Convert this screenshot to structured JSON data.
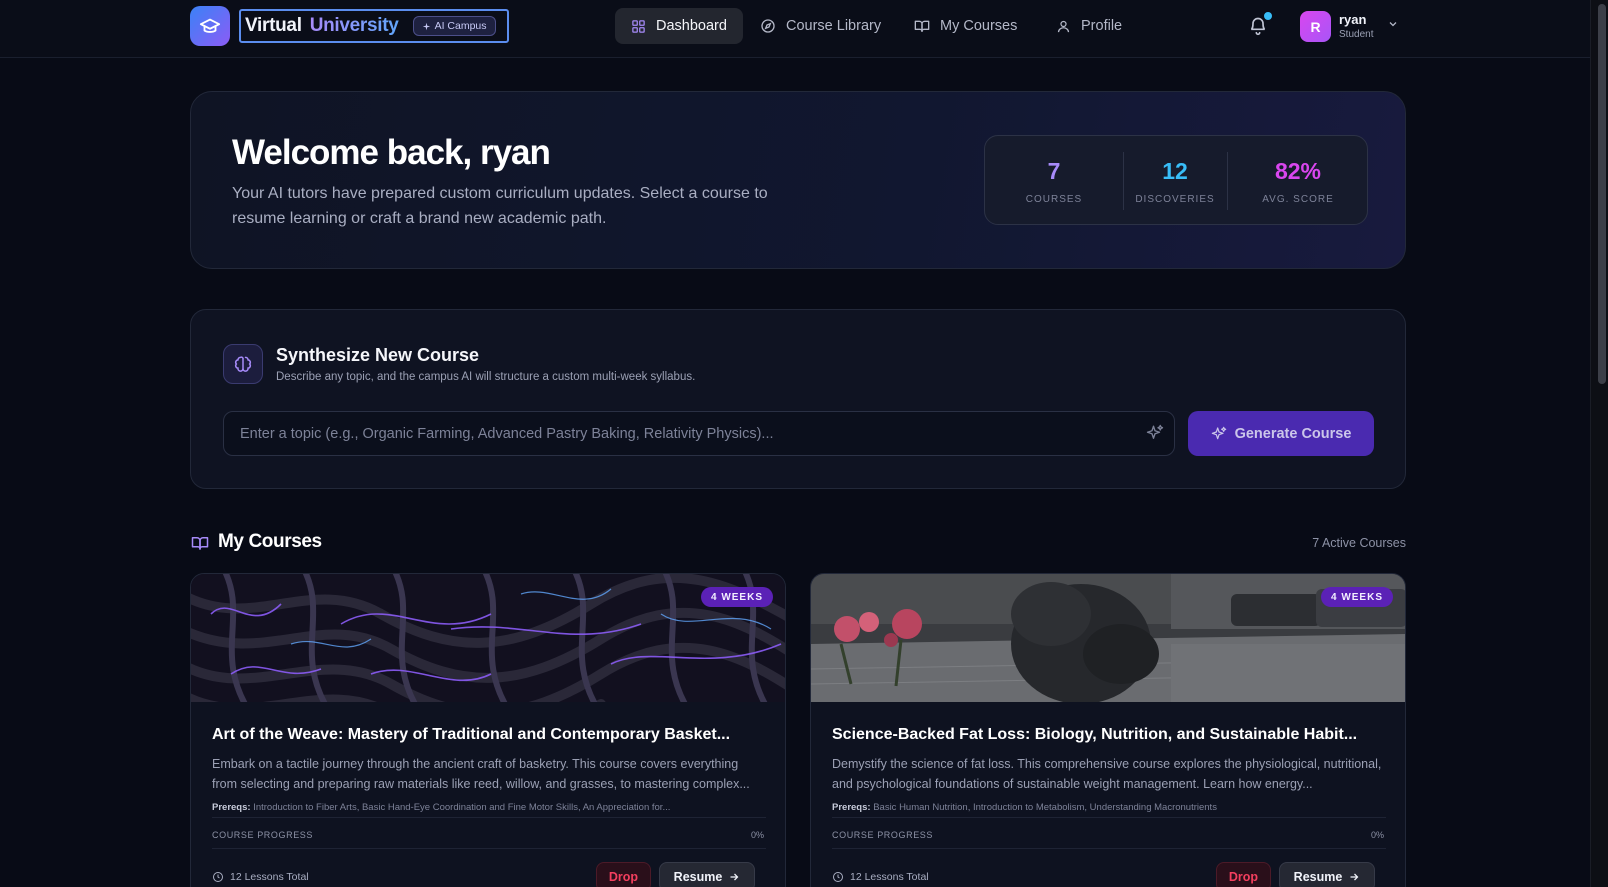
{
  "brand": {
    "name_part1": "Virtual",
    "name_part2": "University",
    "badge": "AI Campus"
  },
  "nav": {
    "items": [
      {
        "label": "Dashboard",
        "icon": "grid-icon",
        "active": true
      },
      {
        "label": "Course Library",
        "icon": "compass-icon",
        "active": false
      },
      {
        "label": "My Courses",
        "icon": "book-open-icon",
        "active": false
      },
      {
        "label": "Profile",
        "icon": "user-icon",
        "active": false
      }
    ]
  },
  "user": {
    "initial": "R",
    "name": "ryan",
    "role": "Student"
  },
  "welcome": {
    "title": "Welcome back, ryan",
    "message": "Your AI tutors have prepared custom curriculum updates. Select a course to resume learning or craft a brand new academic path.",
    "stats": [
      {
        "value": "7",
        "label": "COURSES",
        "color": "#a78bfa"
      },
      {
        "value": "12",
        "label": "DISCOVERIES",
        "color": "#38bdf8"
      },
      {
        "value": "82%",
        "label": "AVG. SCORE",
        "color": "#d946ef"
      }
    ]
  },
  "synthesize": {
    "title": "Synthesize New Course",
    "subtitle": "Describe any topic, and the campus AI will structure a custom multi-week syllabus.",
    "input_value": "",
    "input_placeholder": "Enter a topic (e.g., Organic Farming, Advanced Pastry Baking, Relativity Physics)...",
    "button_label": "Generate Course"
  },
  "my_courses": {
    "title": "My Courses",
    "count_label": "7 Active Courses",
    "courses": [
      {
        "badge": "4 WEEKS",
        "title": "Art of the Weave: Mastery of Traditional and Contemporary Basket...",
        "description": "Embark on a tactile journey through the ancient craft of basketry. This course covers everything from selecting and preparing raw materials like reed, willow, and grasses, to mastering complex...",
        "prereq_label": "Prereqs:",
        "prereqs": "Introduction to Fiber Arts, Basic Hand-Eye Coordination and Fine Motor Skills, An Appreciation for...",
        "progress_label": "COURSE PROGRESS",
        "progress": "0%",
        "lessons": "12 Lessons Total",
        "drop_label": "Drop",
        "resume_label": "Resume"
      },
      {
        "badge": "4 WEEKS",
        "title": "Science-Backed Fat Loss: Biology, Nutrition, and Sustainable Habit...",
        "description": "Demystify the science of fat loss. This comprehensive course explores the physiological, nutritional, and psychological foundations of sustainable weight management. Learn how energy...",
        "prereq_label": "Prereqs:",
        "prereqs": "Basic Human Nutrition, Introduction to Metabolism, Understanding Macronutrients",
        "progress_label": "COURSE PROGRESS",
        "progress": "0%",
        "lessons": "12 Lessons Total",
        "drop_label": "Drop",
        "resume_label": "Resume"
      }
    ]
  }
}
